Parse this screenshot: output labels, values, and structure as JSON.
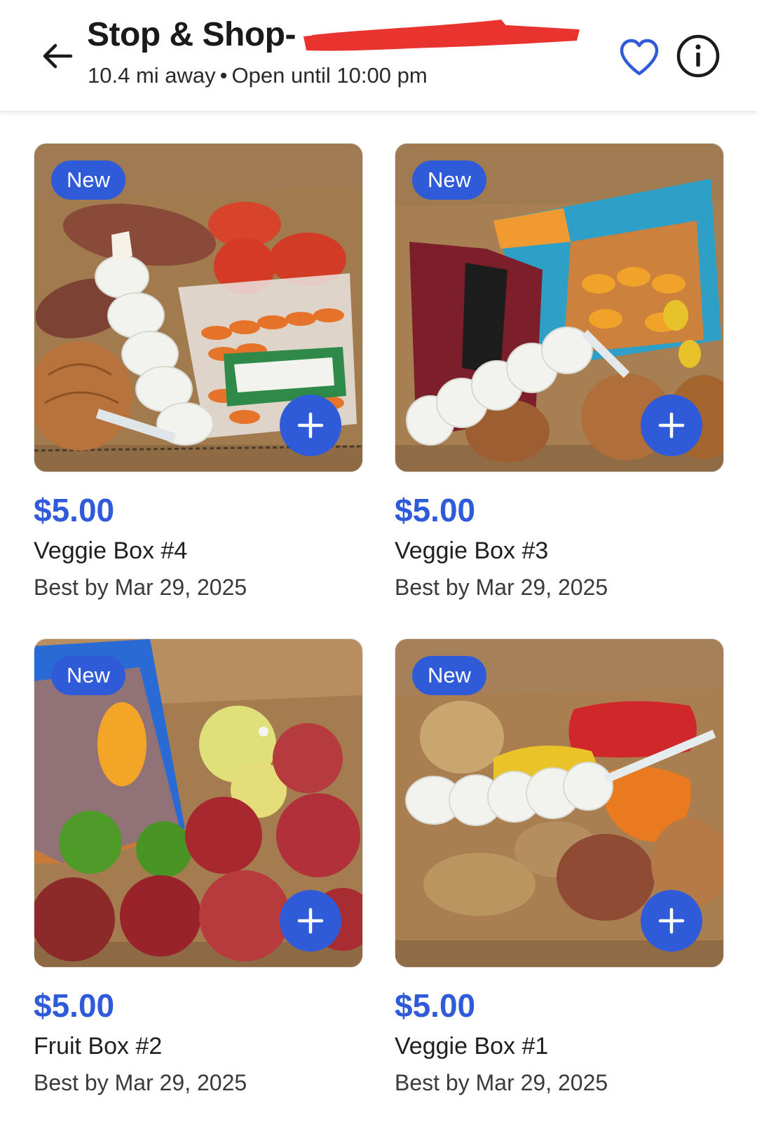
{
  "header": {
    "title": "Stop & Shop-",
    "distance": "10.4 mi away",
    "separator": "•",
    "hours": "Open until 10:00 pm",
    "back_icon": "arrow-left-icon",
    "favorite_icon": "heart-outline-icon",
    "info_icon": "info-circle-icon"
  },
  "colors": {
    "accent": "#2f5bd9",
    "redaction": "#e8332f",
    "text": "#1f1f1f"
  },
  "products": [
    {
      "badge": "New",
      "price": "$5.00",
      "name": "Veggie Box #4",
      "best_by": "Best by Mar 29, 2025",
      "add_icon": "plus-icon"
    },
    {
      "badge": "New",
      "price": "$5.00",
      "name": "Veggie Box #3",
      "best_by": "Best by Mar 29, 2025",
      "add_icon": "plus-icon"
    },
    {
      "badge": "New",
      "price": "$5.00",
      "name": "Fruit Box #2",
      "best_by": "Best by Mar 29, 2025",
      "add_icon": "plus-icon"
    },
    {
      "badge": "New",
      "price": "$5.00",
      "name": "Veggie Box #1",
      "best_by": "Best by Mar 29, 2025",
      "add_icon": "plus-icon"
    }
  ]
}
